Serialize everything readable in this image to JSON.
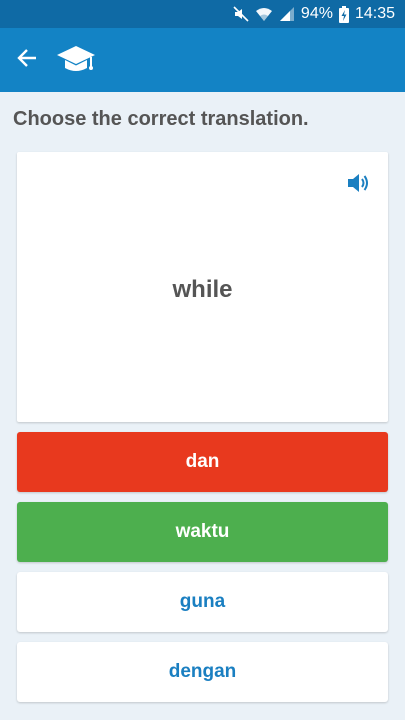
{
  "status_bar": {
    "battery": "94%",
    "time": "14:35",
    "icons": [
      "mute-icon",
      "wifi-icon",
      "signal-icon",
      "battery-charging-icon"
    ]
  },
  "app_bar": {
    "back_icon": "arrow-left-icon",
    "logo_icon": "graduation-cap-icon"
  },
  "quiz": {
    "prompt": "Choose the correct translation.",
    "word": "while",
    "speaker_icon": "speaker-icon",
    "answers": [
      {
        "label": "dan",
        "state": "wrong"
      },
      {
        "label": "waktu",
        "state": "correct"
      },
      {
        "label": "guna",
        "state": "neutral"
      },
      {
        "label": "dengan",
        "state": "neutral"
      }
    ]
  },
  "colors": {
    "status_bar": "#0f6aa5",
    "app_bar": "#1383c5",
    "background": "#eaf1f7",
    "wrong": "#e8391e",
    "correct": "#4daf4e",
    "option_text": "#1a7fc1"
  }
}
